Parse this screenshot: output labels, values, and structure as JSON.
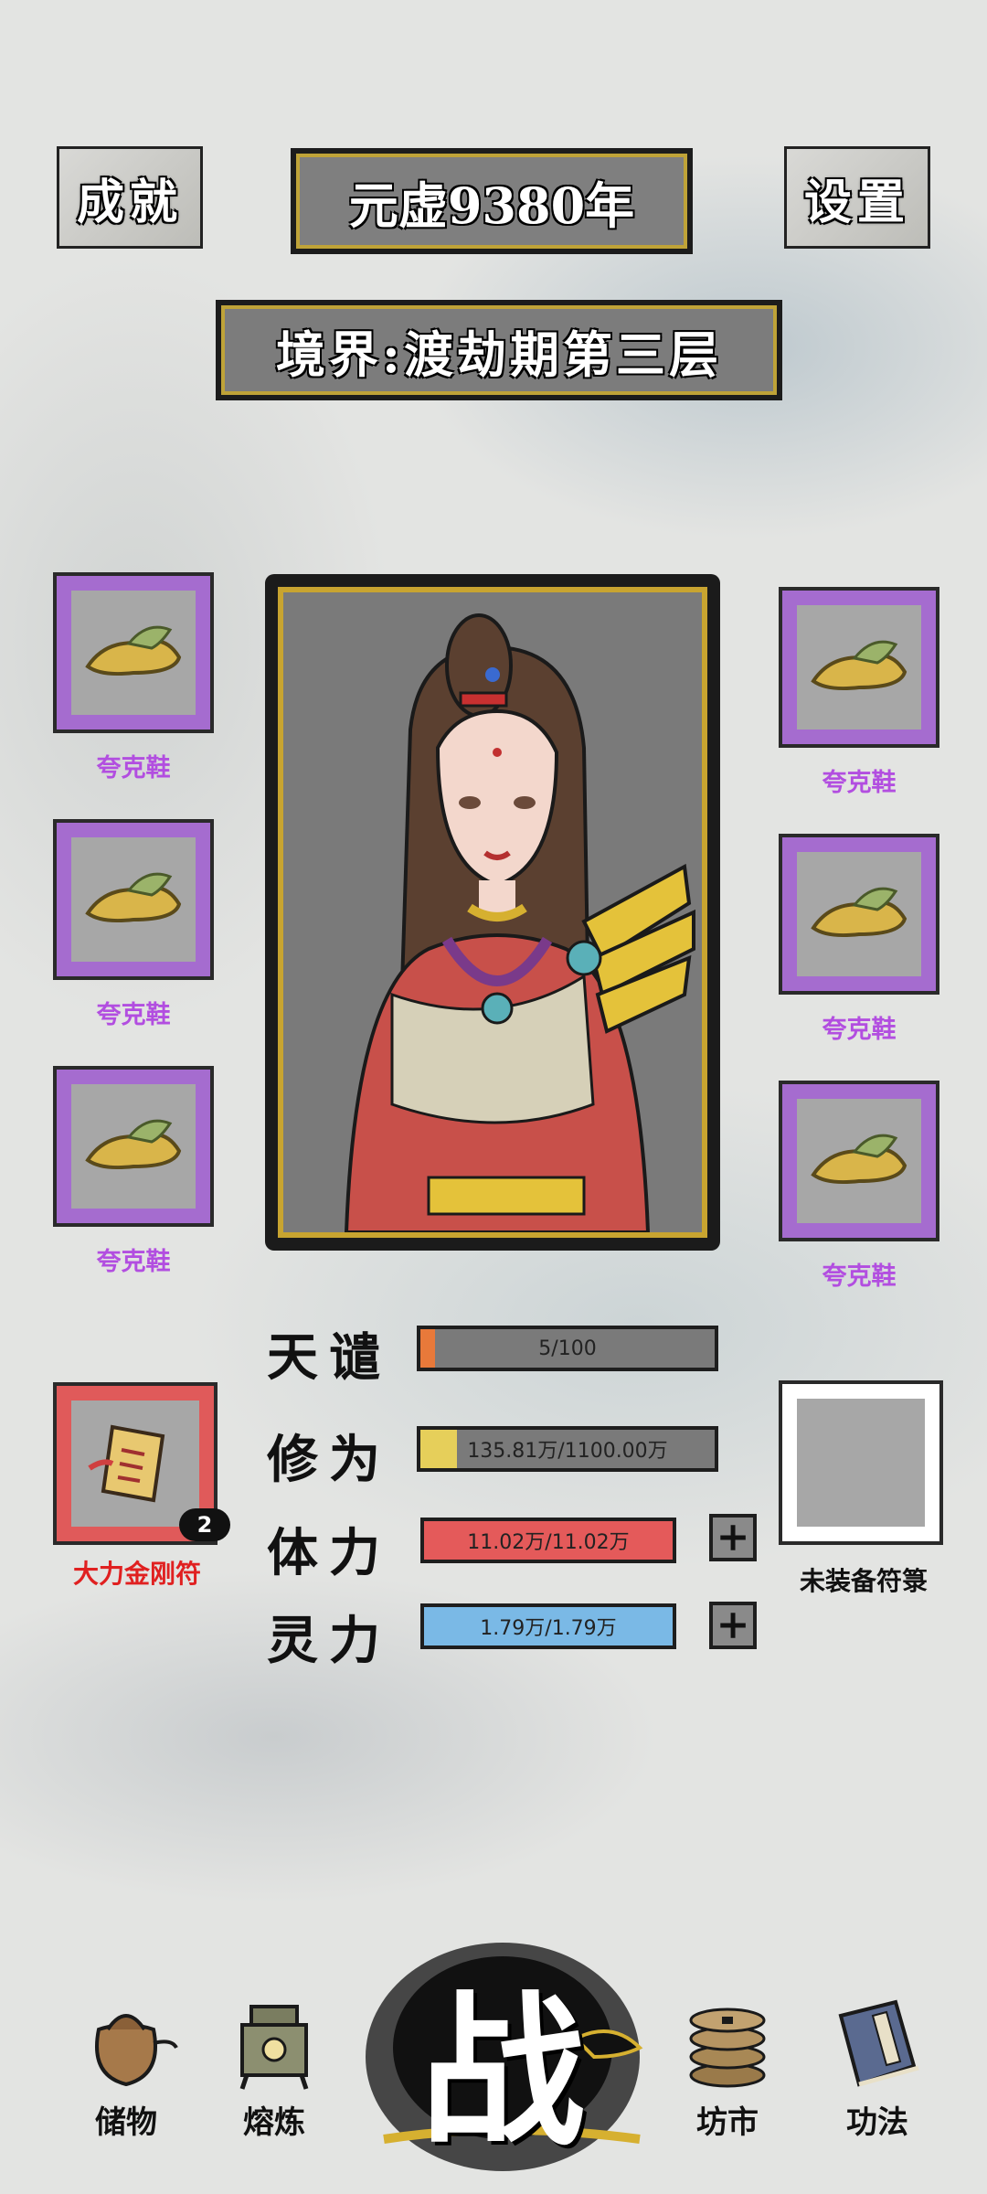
{
  "top": {
    "achievements_label": "成就",
    "year_label": "元虚9380年",
    "settings_label": "设置",
    "realm_label": "境界:渡劫期第三层"
  },
  "equipment": {
    "left": [
      {
        "name": "夸克鞋",
        "icon": "shoe-icon"
      },
      {
        "name": "夸克鞋",
        "icon": "shoe-icon"
      },
      {
        "name": "夸克鞋",
        "icon": "shoe-icon"
      }
    ],
    "right": [
      {
        "name": "夸克鞋",
        "icon": "shoe-icon"
      },
      {
        "name": "夸克鞋",
        "icon": "shoe-icon"
      },
      {
        "name": "夸克鞋",
        "icon": "shoe-icon"
      }
    ]
  },
  "talisman": {
    "equipped_name": "大力金刚符",
    "equipped_count": "2",
    "empty_label": "未装备符箓"
  },
  "stats": {
    "tianqian": {
      "label": "天谴",
      "value": "5/100",
      "fraction": 0.05,
      "color": "#e8793a"
    },
    "xiuwei": {
      "label": "修为",
      "value": "135.81万/1100.00万",
      "fraction": 0.123,
      "color": "#e6cf5a"
    },
    "tili": {
      "label": "体力",
      "value": "11.02万/11.02万",
      "fraction": 1.0,
      "color": "#e45a5a"
    },
    "lingli": {
      "label": "灵力",
      "value": "1.79万/1.79万",
      "fraction": 1.0,
      "color": "#7ab9e6"
    }
  },
  "nav": {
    "storage": "储物",
    "smelting": "熔炼",
    "battle": "战",
    "market": "坊市",
    "skills": "功法"
  },
  "colors": {
    "equip_rarity_purple": "#a56ccf",
    "talisman_red": "#e05a5a",
    "portrait_gold": "#c8a430"
  }
}
